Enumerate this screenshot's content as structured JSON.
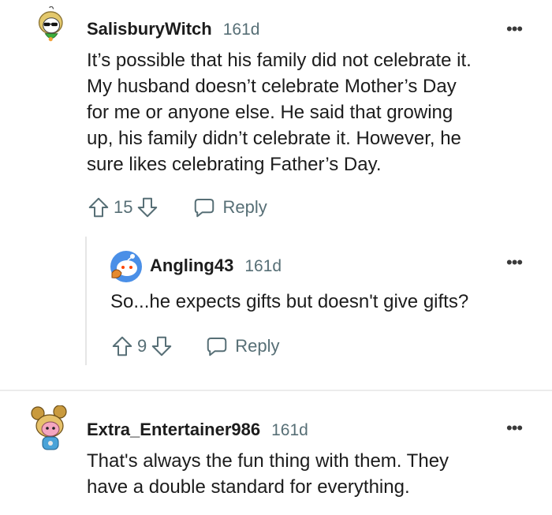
{
  "comments": [
    {
      "username": "SalisburyWitch",
      "age": "161d",
      "more": "•••",
      "lines": [
        "It’s possible that his family did not celebrate it.",
        "My husband doesn’t celebrate Mother’s Day",
        "for me or anyone else. He said that growing",
        "up, his family didn’t celebrate it. However, he",
        "sure likes celebrating Father’s Day."
      ],
      "votes": "15",
      "reply_label": "Reply",
      "avatar_icon": "witch-avatar-icon",
      "accent": "#e8a93a"
    },
    {
      "username": "Angling43",
      "age": "161d",
      "more": "•••",
      "lines": [
        "So...he expects gifts but doesn't give gifts?"
      ],
      "votes": "9",
      "reply_label": "Reply",
      "avatar_icon": "snoo-avatar-icon",
      "accent": "#4a8fe7"
    },
    {
      "username": "Extra_Entertainer986",
      "age": "161d",
      "more": "•••",
      "lines": [
        "That's always the fun thing with them. They",
        "have a double standard for everything."
      ],
      "avatar_icon": "snoo-avatar-icon",
      "accent": "#d9a54a"
    }
  ]
}
